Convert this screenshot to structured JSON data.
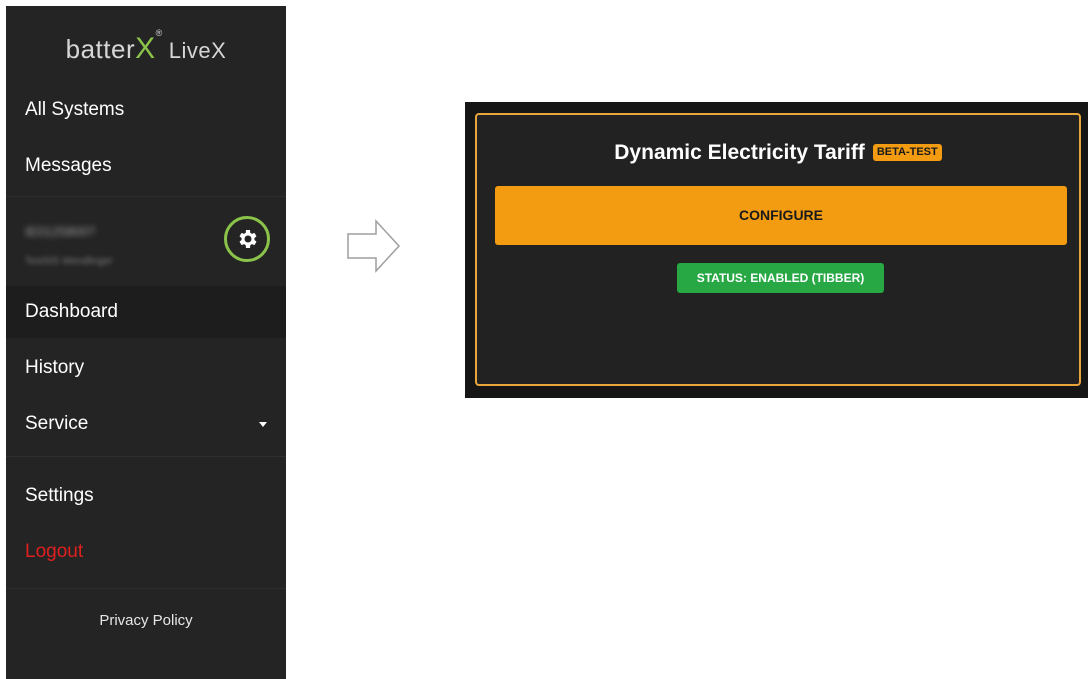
{
  "brand": {
    "name": "batterX",
    "name_prefix": "batter",
    "name_mark": "X",
    "registered": "®",
    "product": "LiveX",
    "accent_color": "#8bc34a"
  },
  "nav": {
    "all_systems": "All Systems",
    "messages": "Messages",
    "dashboard": "Dashboard",
    "history": "History",
    "service": "Service",
    "settings": "Settings",
    "logout": "Logout"
  },
  "device": {
    "id": "IE0125800?",
    "name": "TestSIS Wendlinger",
    "settings_icon": "gear-icon"
  },
  "footer": {
    "privacy": "Privacy Policy"
  },
  "panel": {
    "title": "Dynamic Electricity Tariff",
    "badge": "BETA-TEST",
    "configure_label": "CONFIGURE",
    "status_label": "STATUS: ENABLED (TIBBER)",
    "border_color": "#e8a53a",
    "button_color": "#f39c12",
    "status_color": "#28a745"
  },
  "colors": {
    "sidebar_bg": "#242424",
    "logout": "#e01f1f"
  }
}
